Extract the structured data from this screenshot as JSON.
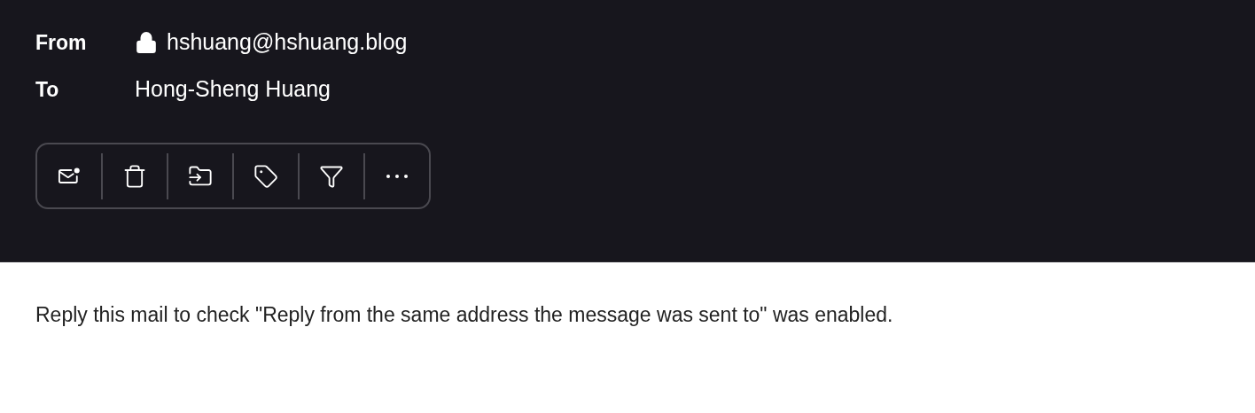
{
  "header": {
    "fields": [
      {
        "label": "From",
        "value": "hshuang@hshuang.blog",
        "locked": true
      },
      {
        "label": "To",
        "value": "Hong-Sheng Huang",
        "locked": false
      }
    ]
  },
  "toolbar": [
    {
      "kind": "unread"
    },
    {
      "kind": "delete"
    },
    {
      "kind": "move"
    },
    {
      "kind": "label"
    },
    {
      "kind": "filter"
    },
    {
      "kind": "more"
    }
  ],
  "body": "Reply this mail to check \"Reply from the same address the message was sent to\" was enabled."
}
